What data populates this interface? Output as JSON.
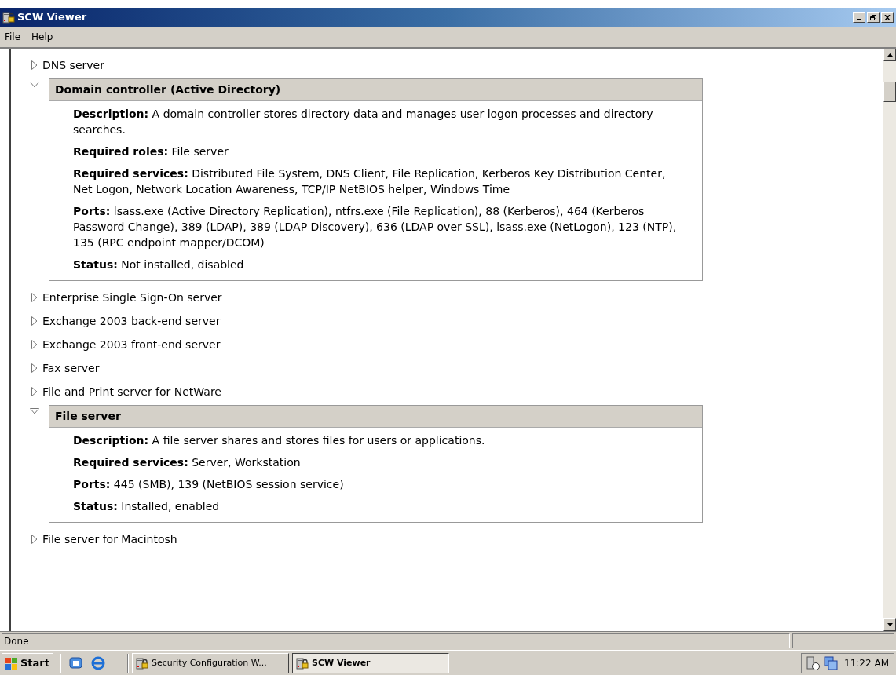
{
  "window": {
    "title": "SCW Viewer"
  },
  "menu": [
    "File",
    "Help"
  ],
  "roles": [
    {
      "name": "DNS server",
      "expanded": false
    },
    {
      "name": "Domain controller (Active Directory)",
      "expanded": true,
      "details": [
        "**Description:**  A domain controller stores directory data and manages user logon processes and directory searches.",
        "**Required roles:**  File server",
        "**Required services:**  Distributed File System,  DNS Client,  File Replication,  Kerberos Key Distribution Center,  Net Logon,  Network Location Awareness,  TCP/IP NetBIOS helper,  Windows Time",
        "**Ports:** lsass.exe (Active Directory Replication), ntfrs.exe (File Replication), 88 (Kerberos), 464 (Kerberos Password Change), 389 (LDAP), 389 (LDAP Discovery), 636 (LDAP over SSL), lsass.exe (NetLogon), 123 (NTP), 135 (RPC endpoint mapper/DCOM)",
        "**Status:**  Not installed, disabled"
      ]
    },
    {
      "name": "Enterprise Single Sign-On server",
      "expanded": false
    },
    {
      "name": "Exchange 2003 back-end server",
      "expanded": false
    },
    {
      "name": "Exchange 2003 front-end server",
      "expanded": false
    },
    {
      "name": "Fax server",
      "expanded": false
    },
    {
      "name": "File and Print server for NetWare",
      "expanded": false
    },
    {
      "name": "File server",
      "expanded": true,
      "details": [
        "**Description:**  A file server shares and stores files for users or applications.",
        "**Required services:**  Server,  Workstation",
        "**Ports:** 445 (SMB), 139 (NetBIOS session service)",
        "**Status:**  Installed, enabled"
      ]
    },
    {
      "name": "File server for Macintosh",
      "expanded": false
    }
  ],
  "status_bar": "Done",
  "taskbar": {
    "start": "Start",
    "tasks": [
      {
        "label": "Security Configuration W...",
        "selected": false
      },
      {
        "label": "SCW Viewer",
        "selected": true
      }
    ],
    "clock": "11:22 AM"
  }
}
